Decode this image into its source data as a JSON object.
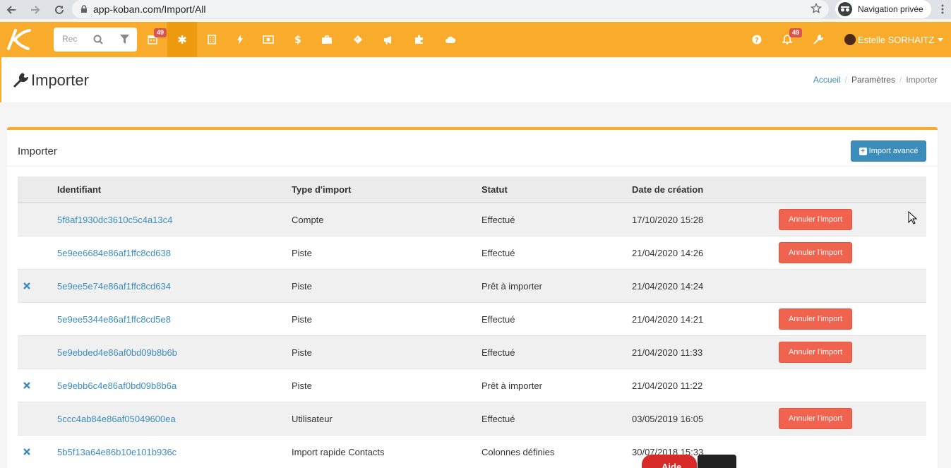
{
  "browser": {
    "url": "app-koban.com/Import/All",
    "private_label": "Navigation privée"
  },
  "navbar": {
    "search_placeholder": "Rec",
    "calendar_badge": "49",
    "notification_badge": "49",
    "user_name": "Estelle SORHAITZ",
    "accent_color": "#f9ab2b",
    "icons": [
      "calendar-icon",
      "asterisk-icon",
      "building-icon",
      "bolt-icon",
      "money-icon",
      "dollar-icon",
      "briefcase-icon",
      "ticket-icon",
      "bullhorn-icon",
      "puzzle-icon",
      "cloud-icon",
      "question-icon",
      "bell-icon",
      "wrench-icon"
    ]
  },
  "page": {
    "title": "Importer",
    "breadcrumb": [
      "Accueil",
      "Paramètres",
      "Importer"
    ]
  },
  "box": {
    "title": "Importer",
    "advanced_import_label": "Import avancé"
  },
  "table": {
    "headers": [
      "Identifiant",
      "Type d'import",
      "Statut",
      "Date de création"
    ],
    "cancel_label": "Annuler l'import",
    "rows": [
      {
        "id": "5f8af1930dc3610c5c4a13c4",
        "type": "Compte",
        "status": "Effectué",
        "date": "17/10/2020 15:28",
        "deletable": false,
        "cancellable": true
      },
      {
        "id": "5e9ee6684e86af1ffc8cd638",
        "type": "Piste",
        "status": "Effectué",
        "date": "21/04/2020 14:26",
        "deletable": false,
        "cancellable": true
      },
      {
        "id": "5e9ee5e74e86af1ffc8cd634",
        "type": "Piste",
        "status": "Prêt à importer",
        "date": "21/04/2020 14:24",
        "deletable": true,
        "cancellable": false
      },
      {
        "id": "5e9ee5344e86af1ffc8cd5e8",
        "type": "Piste",
        "status": "Effectué",
        "date": "21/04/2020 14:21",
        "deletable": false,
        "cancellable": true
      },
      {
        "id": "5e9ebded4e86af0bd09b8b6b",
        "type": "Piste",
        "status": "Effectué",
        "date": "21/04/2020 11:33",
        "deletable": false,
        "cancellable": true
      },
      {
        "id": "5e9ebb6c4e86af0bd09b8b6a",
        "type": "Piste",
        "status": "Prêt à importer",
        "date": "21/04/2020 11:22",
        "deletable": true,
        "cancellable": false
      },
      {
        "id": "5ccc4ab84e86af05049600ea",
        "type": "Utilisateur",
        "status": "Effectué",
        "date": "03/05/2019 16:05",
        "deletable": false,
        "cancellable": true
      },
      {
        "id": "5b5f13a64e86b10e101b936c",
        "type": "Import rapide Contacts",
        "status": "Colonnes définies",
        "date": "30/07/2018 15:33",
        "deletable": true,
        "cancellable": false
      }
    ]
  },
  "help": {
    "label": "Aide"
  }
}
